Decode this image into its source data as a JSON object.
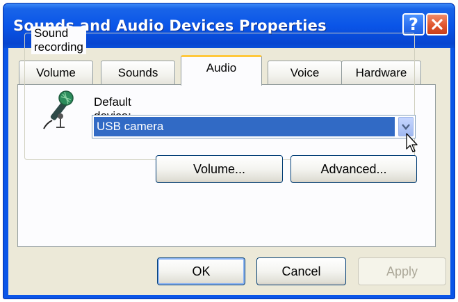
{
  "window": {
    "title": "Sounds and Audio Devices Properties",
    "help_label": "?",
    "tabs": [
      {
        "label": "Volume",
        "active": false
      },
      {
        "label": "Sounds",
        "active": false
      },
      {
        "label": "Audio",
        "active": true
      },
      {
        "label": "Voice",
        "active": false
      },
      {
        "label": "Hardware",
        "active": false
      }
    ]
  },
  "sound_recording": {
    "group_label": "Sound recording",
    "default_device_label": "Default device:",
    "selected_device": "USB camera",
    "volume_button": "Volume...",
    "advanced_button": "Advanced..."
  },
  "footer": {
    "ok_label": "OK",
    "cancel_label": "Cancel",
    "apply_label": "Apply"
  },
  "colors": {
    "titlebar": "#0a55e8",
    "client_bg": "#ece9d8",
    "selection": "#316ac5",
    "active_tab_accent": "#ffc83c",
    "close_button": "#e0562e"
  }
}
